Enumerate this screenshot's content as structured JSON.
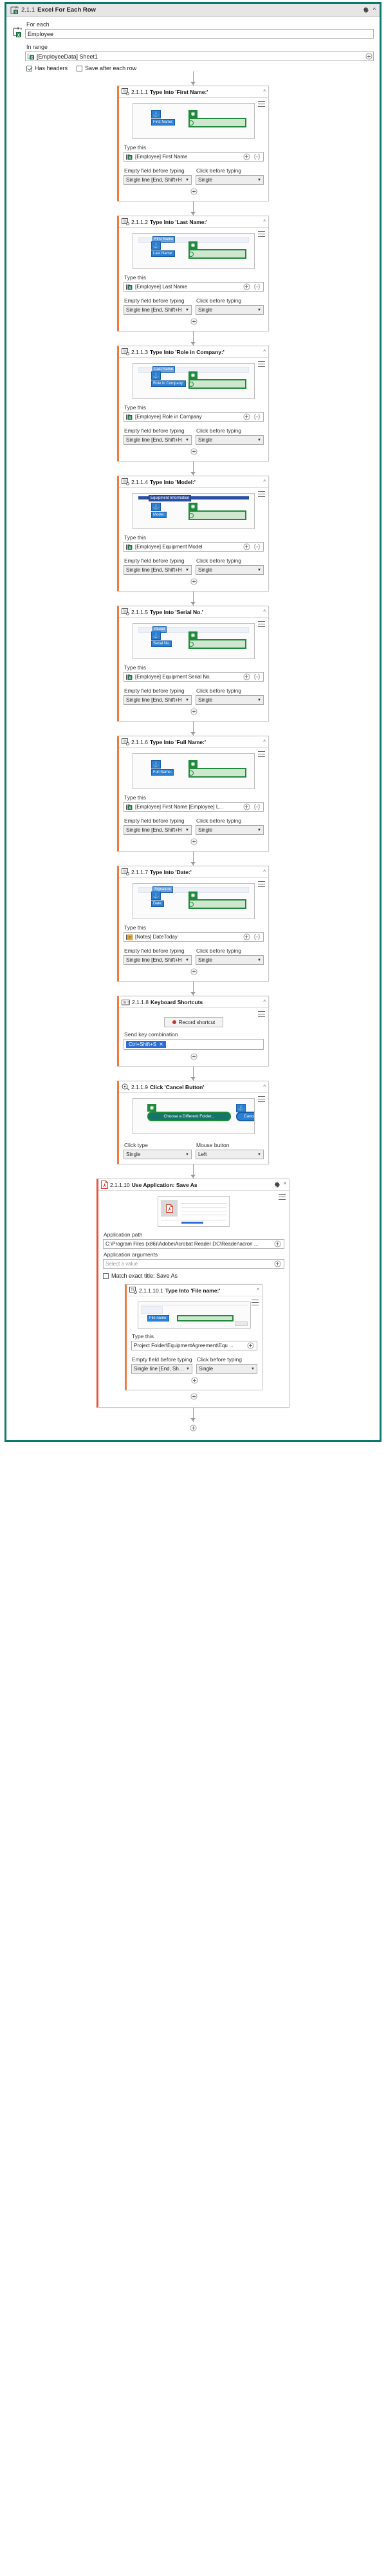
{
  "root": {
    "index": "2.1.1",
    "title": "Excel For Each Row",
    "icon": "excel-for-each-icon",
    "for_each_label": "For each",
    "for_each_value": "Employee",
    "in_range_label": "In range",
    "in_range_value": "[EmployeeData] Sheet1",
    "has_headers_label": "Has headers",
    "has_headers_checked": true,
    "save_after_label": "Save after each row",
    "save_after_checked": false,
    "gear_icon": "gear-icon",
    "collapse_icon": "chevron-up-icon"
  },
  "labels": {
    "type_this": "Type this",
    "empty_field": "Empty field before typing",
    "click_before": "Click before typing",
    "click_type": "Click type",
    "mouse_button": "Mouse button",
    "send_key_combination": "Send key combination",
    "record_shortcut": "Record shortcut",
    "application_path": "Application path",
    "application_arguments": "Application arguments",
    "match_exact_title": "Match exact title: Save As",
    "select_value_placeholder": "Select a value",
    "add_icon": "plus-circle-icon",
    "menu_icon": "hamburger-menu-icon",
    "collapse_icon": "chevron-up-icon"
  },
  "steps": [
    {
      "index": "2.1.1.1",
      "title": "Type Into 'First Name:'",
      "icon": "type-into-icon",
      "anchor_label": "First Name:",
      "type_this": "[Employee] First Name",
      "type_this_icon": "excel-variable-icon",
      "empty_field_value": "Single line [End, Shift+H",
      "click_before_value": "Single",
      "shot_variant": "field-right"
    },
    {
      "index": "2.1.1.2",
      "title": "Type Into 'Last Name:'",
      "icon": "type-into-icon",
      "anchor_label": "Last Name:",
      "type_this": "[Employee] Last Name",
      "type_this_icon": "excel-variable-icon",
      "empty_field_value": "Single line [End, Shift+H",
      "click_before_value": "Single",
      "shot_variant": "field-below",
      "shot_top_label": "First Name"
    },
    {
      "index": "2.1.1.3",
      "title": "Type Into 'Role in Company:'",
      "icon": "type-into-icon",
      "anchor_label": "Role in Company:",
      "type_this": "[Employee] Role in Company",
      "type_this_icon": "excel-variable-icon",
      "empty_field_value": "Single line [End, Shift+H",
      "click_before_value": "Single",
      "shot_variant": "field-below",
      "shot_top_label": "Last Name"
    },
    {
      "index": "2.1.1.4",
      "title": "Type Into 'Model:'",
      "icon": "type-into-icon",
      "anchor_label": "Model:",
      "type_this": "[Employee] Equipment Model",
      "type_this_icon": "excel-variable-icon",
      "empty_field_value": "Single line [End, Shift+H",
      "click_before_value": "Single",
      "shot_variant": "header-band",
      "shot_top_label": "Equipment Information"
    },
    {
      "index": "2.1.1.5",
      "title": "Type Into 'Serial No.'",
      "icon": "type-into-icon",
      "anchor_label": "Serial No.",
      "type_this": "[Employee] Equipment Serial No.",
      "type_this_icon": "excel-variable-icon",
      "empty_field_value": "Single line [End, Shift+H",
      "click_before_value": "Single",
      "shot_variant": "field-below",
      "shot_top_label": "Model"
    },
    {
      "index": "2.1.1.6",
      "title": "Type Into 'Full Name:'",
      "icon": "type-into-icon",
      "anchor_label": "Full Name:",
      "type_this": "[Employee] First Name  [Employee] L...",
      "type_this_icon": "excel-variable-icon",
      "empty_field_value": "Single line [End, Shift+H",
      "click_before_value": "Single",
      "shot_variant": "field-right"
    },
    {
      "index": "2.1.1.7",
      "title": "Type Into 'Date:'",
      "icon": "type-into-icon",
      "anchor_label": "Date:",
      "type_this": "[Notes] DateToday",
      "type_this_icon": "notes-variable-icon",
      "empty_field_value": "Single line [End, Shift+H",
      "click_before_value": "Single",
      "shot_variant": "field-below",
      "shot_top_label": "Signature"
    }
  ],
  "keyboard_step": {
    "index": "2.1.1.8",
    "title": "Keyboard Shortcuts",
    "icon": "keyboard-icon",
    "record_label": "Record shortcut",
    "send_label": "Send key combination",
    "key_chip": "Ctrl+Shift+S",
    "remove_icon": "close-icon"
  },
  "click_step": {
    "index": "2.1.1.9",
    "title": "Click 'Cancel Button'",
    "icon": "click-icon",
    "shot_button_label": "Choose a Different Folder...",
    "shot_target_label": "Cancel",
    "click_type_label": "Click type",
    "click_type_value": "Single",
    "mouse_button_label": "Mouse button",
    "mouse_button_value": "Left"
  },
  "app_step": {
    "index": "2.1.1.10",
    "title": "Use Application: Save As",
    "icon": "pdf-icon",
    "application_path_label": "Application path",
    "application_path_value": "C:\\Program Files (x86)\\Adobe\\Acrobat Reader DC\\Reader\\acron ...",
    "application_arguments_label": "Application arguments",
    "application_arguments_placeholder": "Select a value",
    "match_exact_title_label": "Match exact title: Save As",
    "match_exact_title_checked": false,
    "nested": {
      "index": "2.1.1.10.1",
      "title": "Type Into 'File name:'",
      "icon": "type-into-icon",
      "type_this": "Project Folder\\EquipmentAgreement\\Equ ...",
      "type_this_icon": "folder-variable-icon",
      "empty_field_value": "Single line [End, Shift+H",
      "click_before_value": "Single",
      "anchor_label": "File name:"
    }
  },
  "colors": {
    "container_border": "#0a7a6e",
    "card_accent": "#f07b3f",
    "app_accent": "#e8523f",
    "target_green": "#1f8a3b",
    "anchor_blue": "#2b7fd4",
    "excel_green": "#1d7044",
    "key_chip_blue": "#2b6fd4"
  }
}
